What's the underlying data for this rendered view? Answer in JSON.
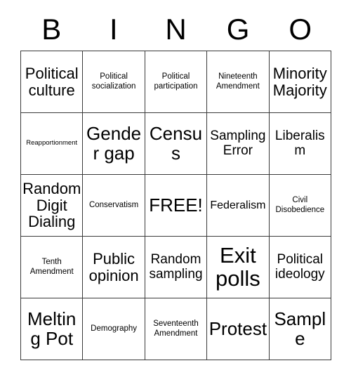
{
  "card": {
    "title": "BINGO",
    "header_letters": [
      "B",
      "I",
      "N",
      "G",
      "O"
    ],
    "free_space": "FREE!",
    "border_color": "#3a3a3a",
    "text_color": "#000000",
    "background_color": "#ffffff",
    "rows": 5,
    "columns": 5,
    "cells": [
      [
        {
          "label": "Political culture",
          "size": "xl"
        },
        {
          "label": "Political socialization",
          "size": "sm"
        },
        {
          "label": "Political participation",
          "size": "sm"
        },
        {
          "label": "Nineteenth Amendment",
          "size": "sm"
        },
        {
          "label": "Minority Majority",
          "size": "xl"
        }
      ],
      [
        {
          "label": "Reapportionment",
          "size": "xs"
        },
        {
          "label": "Gender gap",
          "size": "xxl"
        },
        {
          "label": "Census",
          "size": "xxl"
        },
        {
          "label": "Sampling Error",
          "size": "lg"
        },
        {
          "label": "Liberalism",
          "size": "lg"
        }
      ],
      [
        {
          "label": "Random Digit Dialing",
          "size": "xl"
        },
        {
          "label": "Conservatism",
          "size": "sm"
        },
        {
          "label": "FREE!",
          "size": "xxl",
          "free": true
        },
        {
          "label": "Federalism",
          "size": "md"
        },
        {
          "label": "Civil Disobedience",
          "size": "sm"
        }
      ],
      [
        {
          "label": "Tenth Amendment",
          "size": "sm"
        },
        {
          "label": "Public opinion",
          "size": "xl"
        },
        {
          "label": "Random sampling",
          "size": "lg"
        },
        {
          "label": "Exit polls",
          "size": "huge"
        },
        {
          "label": "Political ideology",
          "size": "lg"
        }
      ],
      [
        {
          "label": "Melting Pot",
          "size": "xxl"
        },
        {
          "label": "Demography",
          "size": "sm"
        },
        {
          "label": "Seventeenth Amendment",
          "size": "sm"
        },
        {
          "label": "Protest",
          "size": "xxl"
        },
        {
          "label": "Sample",
          "size": "xxl"
        }
      ]
    ]
  }
}
